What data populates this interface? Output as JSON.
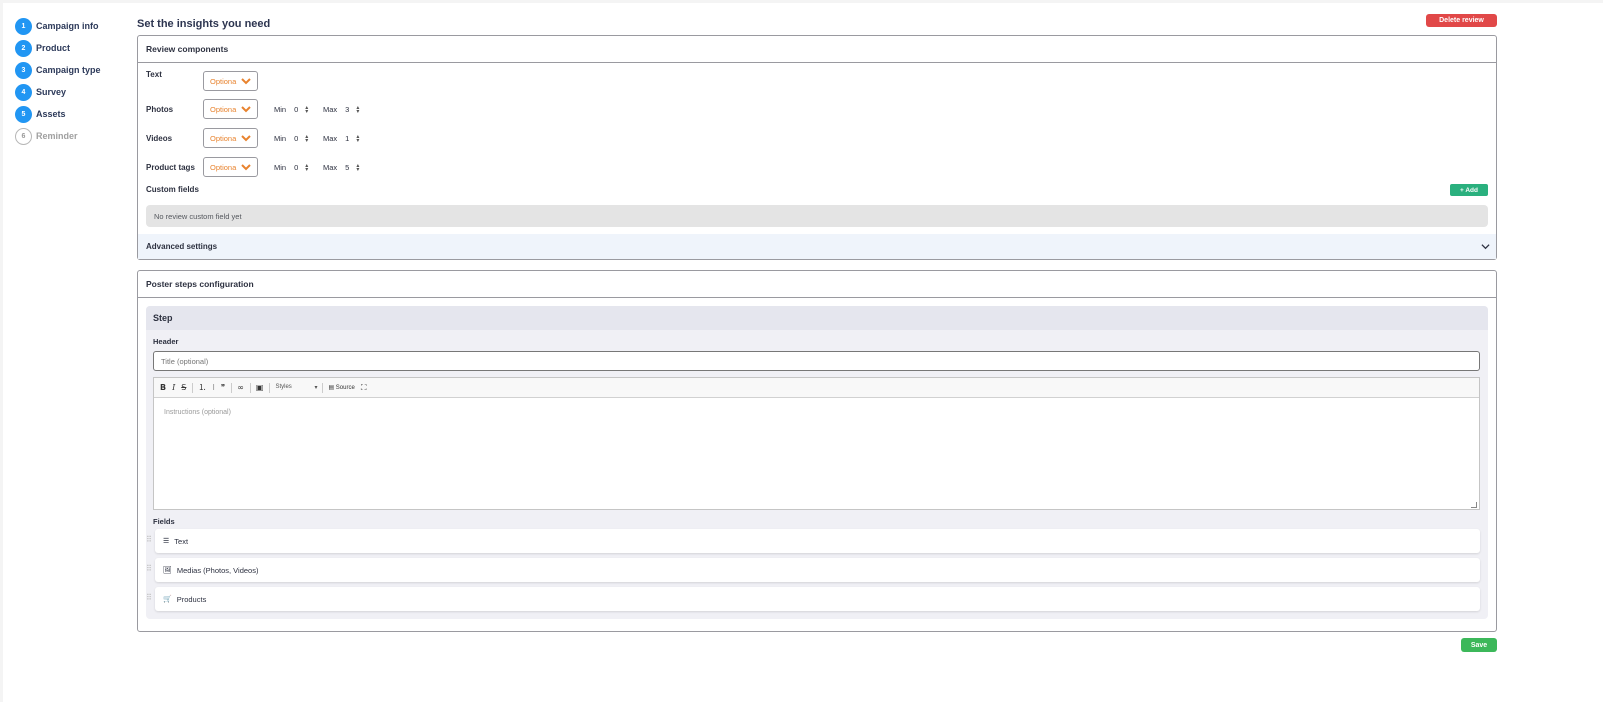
{
  "stepper": {
    "steps": [
      {
        "num": "1",
        "label": "Campaign info"
      },
      {
        "num": "2",
        "label": "Product"
      },
      {
        "num": "3",
        "label": "Campaign type"
      },
      {
        "num": "4",
        "label": "Survey"
      },
      {
        "num": "5",
        "label": "Assets"
      },
      {
        "num": "6",
        "label": "Reminder"
      }
    ]
  },
  "header": {
    "title": "Set the insights you need",
    "delete_label": "Delete review"
  },
  "review": {
    "title": "Review components",
    "components": [
      {
        "label": "Text",
        "select": "Optiona"
      },
      {
        "label": "Photos",
        "select": "Optiona",
        "min_label": "Min",
        "min": "0",
        "max_label": "Max",
        "max": "3"
      },
      {
        "label": "Videos",
        "select": "Optiona",
        "min_label": "Min",
        "min": "0",
        "max_label": "Max",
        "max": "1"
      },
      {
        "label": "Product tags",
        "select": "Optiona",
        "min_label": "Min",
        "min": "0",
        "max_label": "Max",
        "max": "5"
      }
    ],
    "custom_fields_label": "Custom fields",
    "add_label": "+ Add",
    "empty_text": "No review custom field yet",
    "advanced_label": "Advanced settings"
  },
  "poster": {
    "title": "Poster steps configuration",
    "step_title": "Step",
    "header_label": "Header",
    "title_placeholder": "Title (optional)",
    "toolbar": {
      "styles": "Styles",
      "source": "Source"
    },
    "instructions_placeholder": "Instructions (optional)",
    "fields_label": "Fields",
    "fields": [
      {
        "icon": "☰",
        "label": "Text"
      },
      {
        "icon": "🖼",
        "label": "Medias (Photos, Videos)"
      },
      {
        "icon": "🛒",
        "label": "Products"
      }
    ]
  },
  "save_label": "Save",
  "colors": {
    "step_active": "#2196f3",
    "delete": "#e14848",
    "add": "#2ab07e",
    "save": "#3cb85a",
    "select_text": "#e8832e"
  }
}
